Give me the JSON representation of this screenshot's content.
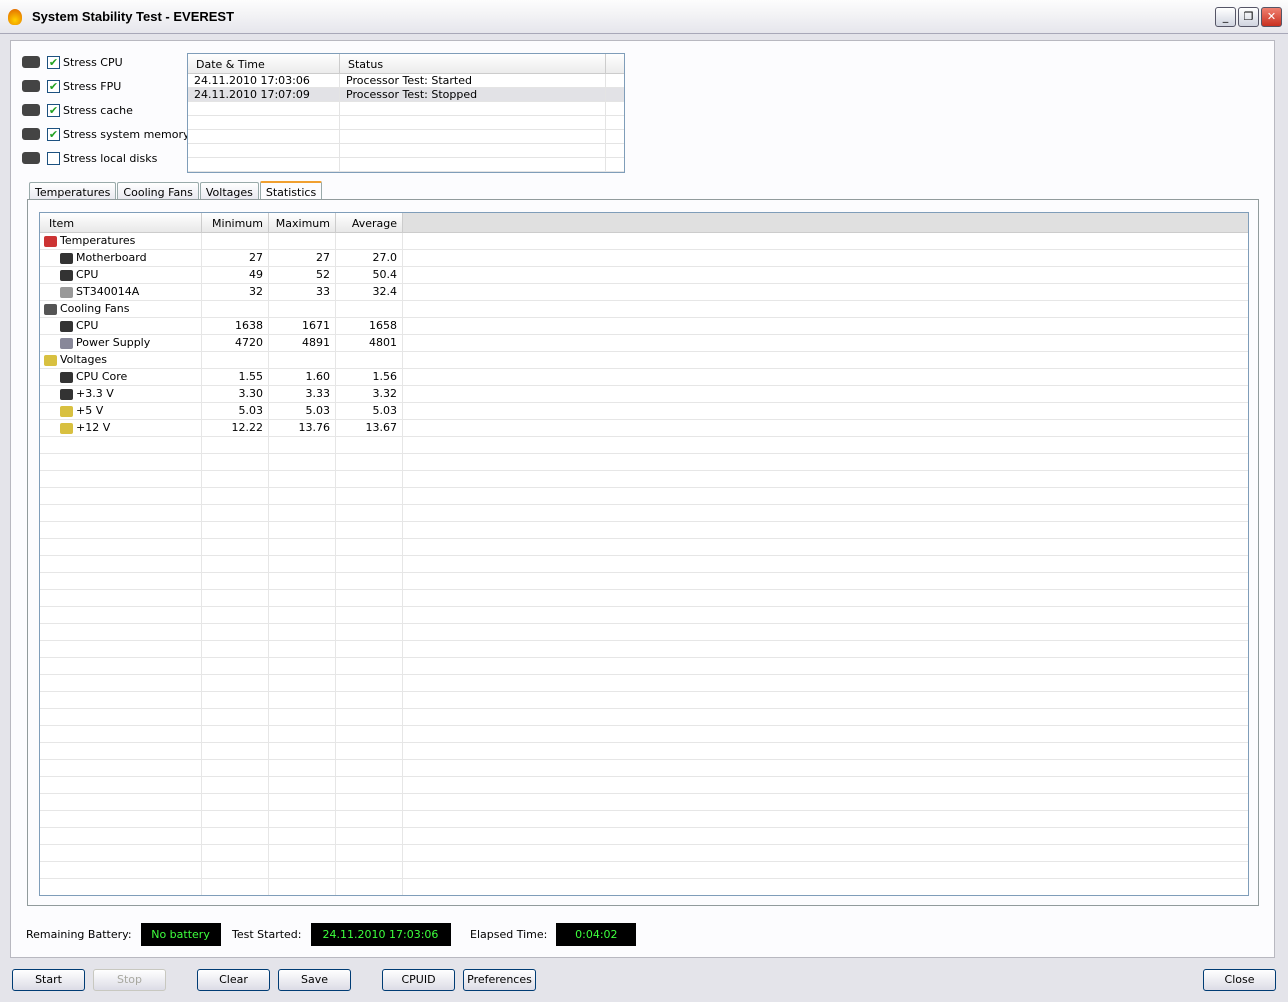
{
  "window": {
    "title": "System Stability Test - EVEREST",
    "minimize": "_",
    "restore": "❐",
    "close": "✕"
  },
  "stress_options": [
    {
      "label": "Stress CPU",
      "checked": true
    },
    {
      "label": "Stress FPU",
      "checked": true
    },
    {
      "label": "Stress cache",
      "checked": true
    },
    {
      "label": "Stress system memory",
      "checked": true
    },
    {
      "label": "Stress local disks",
      "checked": false
    }
  ],
  "log": {
    "headers": [
      "Date & Time",
      "Status"
    ],
    "rows": [
      {
        "time": "24.11.2010 17:03:06",
        "status": "Processor Test: Started"
      },
      {
        "time": "24.11.2010 17:07:09",
        "status": "Processor Test: Stopped"
      }
    ]
  },
  "tabs": [
    "Temperatures",
    "Cooling Fans",
    "Voltages",
    "Statistics"
  ],
  "stats": {
    "headers": [
      "Item",
      "Minimum",
      "Maximum",
      "Average"
    ],
    "rows": [
      {
        "item": "Temperatures",
        "group": true,
        "icon": "thermometer-icon"
      },
      {
        "item": "Motherboard",
        "min": "27",
        "max": "27",
        "avg": "27.0",
        "icon": "motherboard-icon"
      },
      {
        "item": "CPU",
        "min": "49",
        "max": "52",
        "avg": "50.4",
        "icon": "cpu-icon"
      },
      {
        "item": "ST340014A",
        "min": "32",
        "max": "33",
        "avg": "32.4",
        "icon": "disk-icon"
      },
      {
        "item": "Cooling Fans",
        "group": true,
        "icon": "fan-icon"
      },
      {
        "item": "CPU",
        "min": "1638",
        "max": "1671",
        "avg": "1658",
        "icon": "cpu-icon"
      },
      {
        "item": "Power Supply",
        "min": "4720",
        "max": "4891",
        "avg": "4801",
        "icon": "power-supply-icon"
      },
      {
        "item": "Voltages",
        "group": true,
        "icon": "voltage-icon"
      },
      {
        "item": "CPU Core",
        "min": "1.55",
        "max": "1.60",
        "avg": "1.56",
        "icon": "cpu-icon"
      },
      {
        "item": "+3.3 V",
        "min": "3.30",
        "max": "3.33",
        "avg": "3.32",
        "icon": "cpu-icon"
      },
      {
        "item": "+5 V",
        "min": "5.03",
        "max": "5.03",
        "avg": "5.03",
        "icon": "voltage-icon"
      },
      {
        "item": "+12 V",
        "min": "12.22",
        "max": "13.76",
        "avg": "13.67",
        "icon": "voltage-icon"
      }
    ]
  },
  "status": {
    "battery_label": "Remaining Battery:",
    "battery": "No battery",
    "started_label": "Test Started:",
    "started": "24.11.2010 17:03:06",
    "elapsed_label": "Elapsed Time:",
    "elapsed": "0:04:02"
  },
  "buttons": {
    "start": "Start",
    "stop": "Stop",
    "clear": "Clear",
    "save": "Save",
    "cpuid": "CPUID",
    "preferences": "Preferences",
    "close": "Close"
  }
}
